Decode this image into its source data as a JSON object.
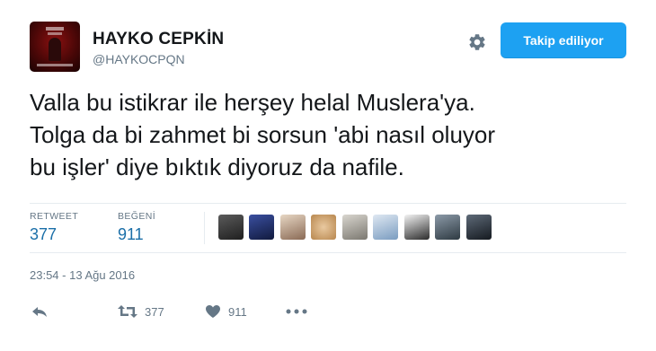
{
  "author": {
    "display_name": "HAYKO CEPKİN",
    "handle": "@HAYKOCPQN"
  },
  "header": {
    "follow_label": "Takip ediliyor",
    "settings_icon": "gear-icon"
  },
  "tweet": {
    "lines": [
      "Valla bu istikrar ile herşey helal Muslera'ya.",
      "Tolga da bi zahmet bi sorsun 'abi nasıl oluyor",
      "bu işler' diye bıktık diyoruz da nafile."
    ]
  },
  "stats": {
    "retweet_label": "RETWEET",
    "retweet_count": "377",
    "like_label": "BEĞENİ",
    "like_count": "911"
  },
  "likers_count_shown": 9,
  "timestamp": "23:54 - 13 Ağu 2016",
  "actions": {
    "reply_icon": "reply-icon",
    "retweet_icon": "retweet-icon",
    "retweet_count": "377",
    "like_icon": "heart-icon",
    "like_count": "911",
    "more_icon": "more-icon"
  },
  "colors": {
    "accent": "#1da1f2",
    "stat_value": "#1b6fa8",
    "muted": "#657786",
    "text": "#14171a"
  }
}
